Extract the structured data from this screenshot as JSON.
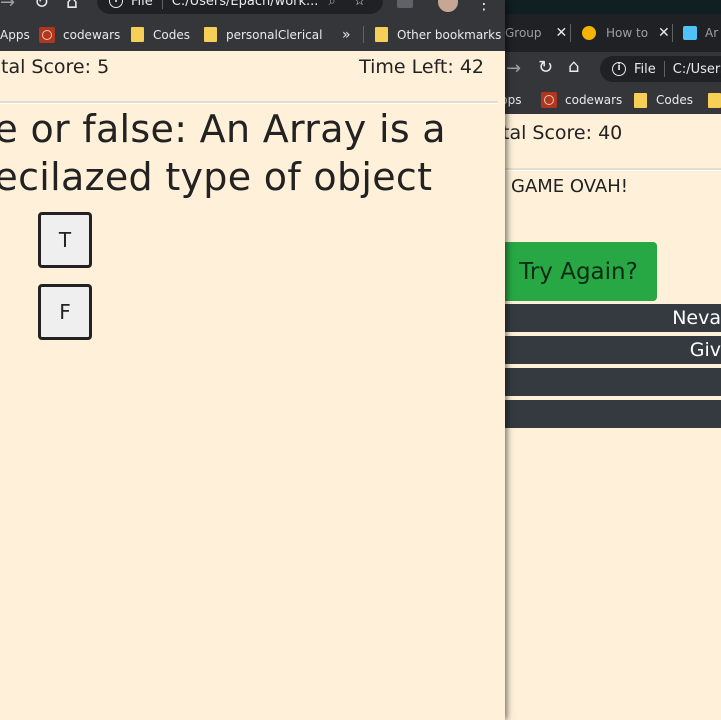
{
  "left_window": {
    "address": {
      "scheme_label": "File",
      "url_fragment": "C:/Users/Epach/work..."
    },
    "bookmarks": [
      {
        "label": "Apps"
      },
      {
        "label": "codewars"
      },
      {
        "label": "Codes"
      },
      {
        "label": "personalClerical"
      },
      {
        "label": "»"
      },
      {
        "label": "Other bookmarks"
      }
    ],
    "quiz": {
      "total_score": "tal Score: 5",
      "time_left": "Time Left: 42",
      "question_line1": "ue or false: An Array is a",
      "question_line2": "pecilazed type of object",
      "answers": [
        {
          "label": "T"
        },
        {
          "label": "F"
        }
      ]
    }
  },
  "right_window": {
    "tabs": [
      {
        "label": "Group"
      },
      {
        "label": "How to"
      },
      {
        "label": "Ar"
      }
    ],
    "address": {
      "scheme_label": "File",
      "url_fragment": "C:/Users"
    },
    "bookmarks": [
      {
        "label": "pps"
      },
      {
        "label": "codewars"
      },
      {
        "label": "Codes"
      }
    ],
    "game": {
      "total_score": "tal Score: 40",
      "game_over": "GAME OVAH!",
      "try_again_label": "Try Again?",
      "high_scores": [
        {
          "text": "Neva"
        },
        {
          "text": "Giv"
        },
        {
          "text": ""
        },
        {
          "text": ""
        }
      ]
    }
  }
}
